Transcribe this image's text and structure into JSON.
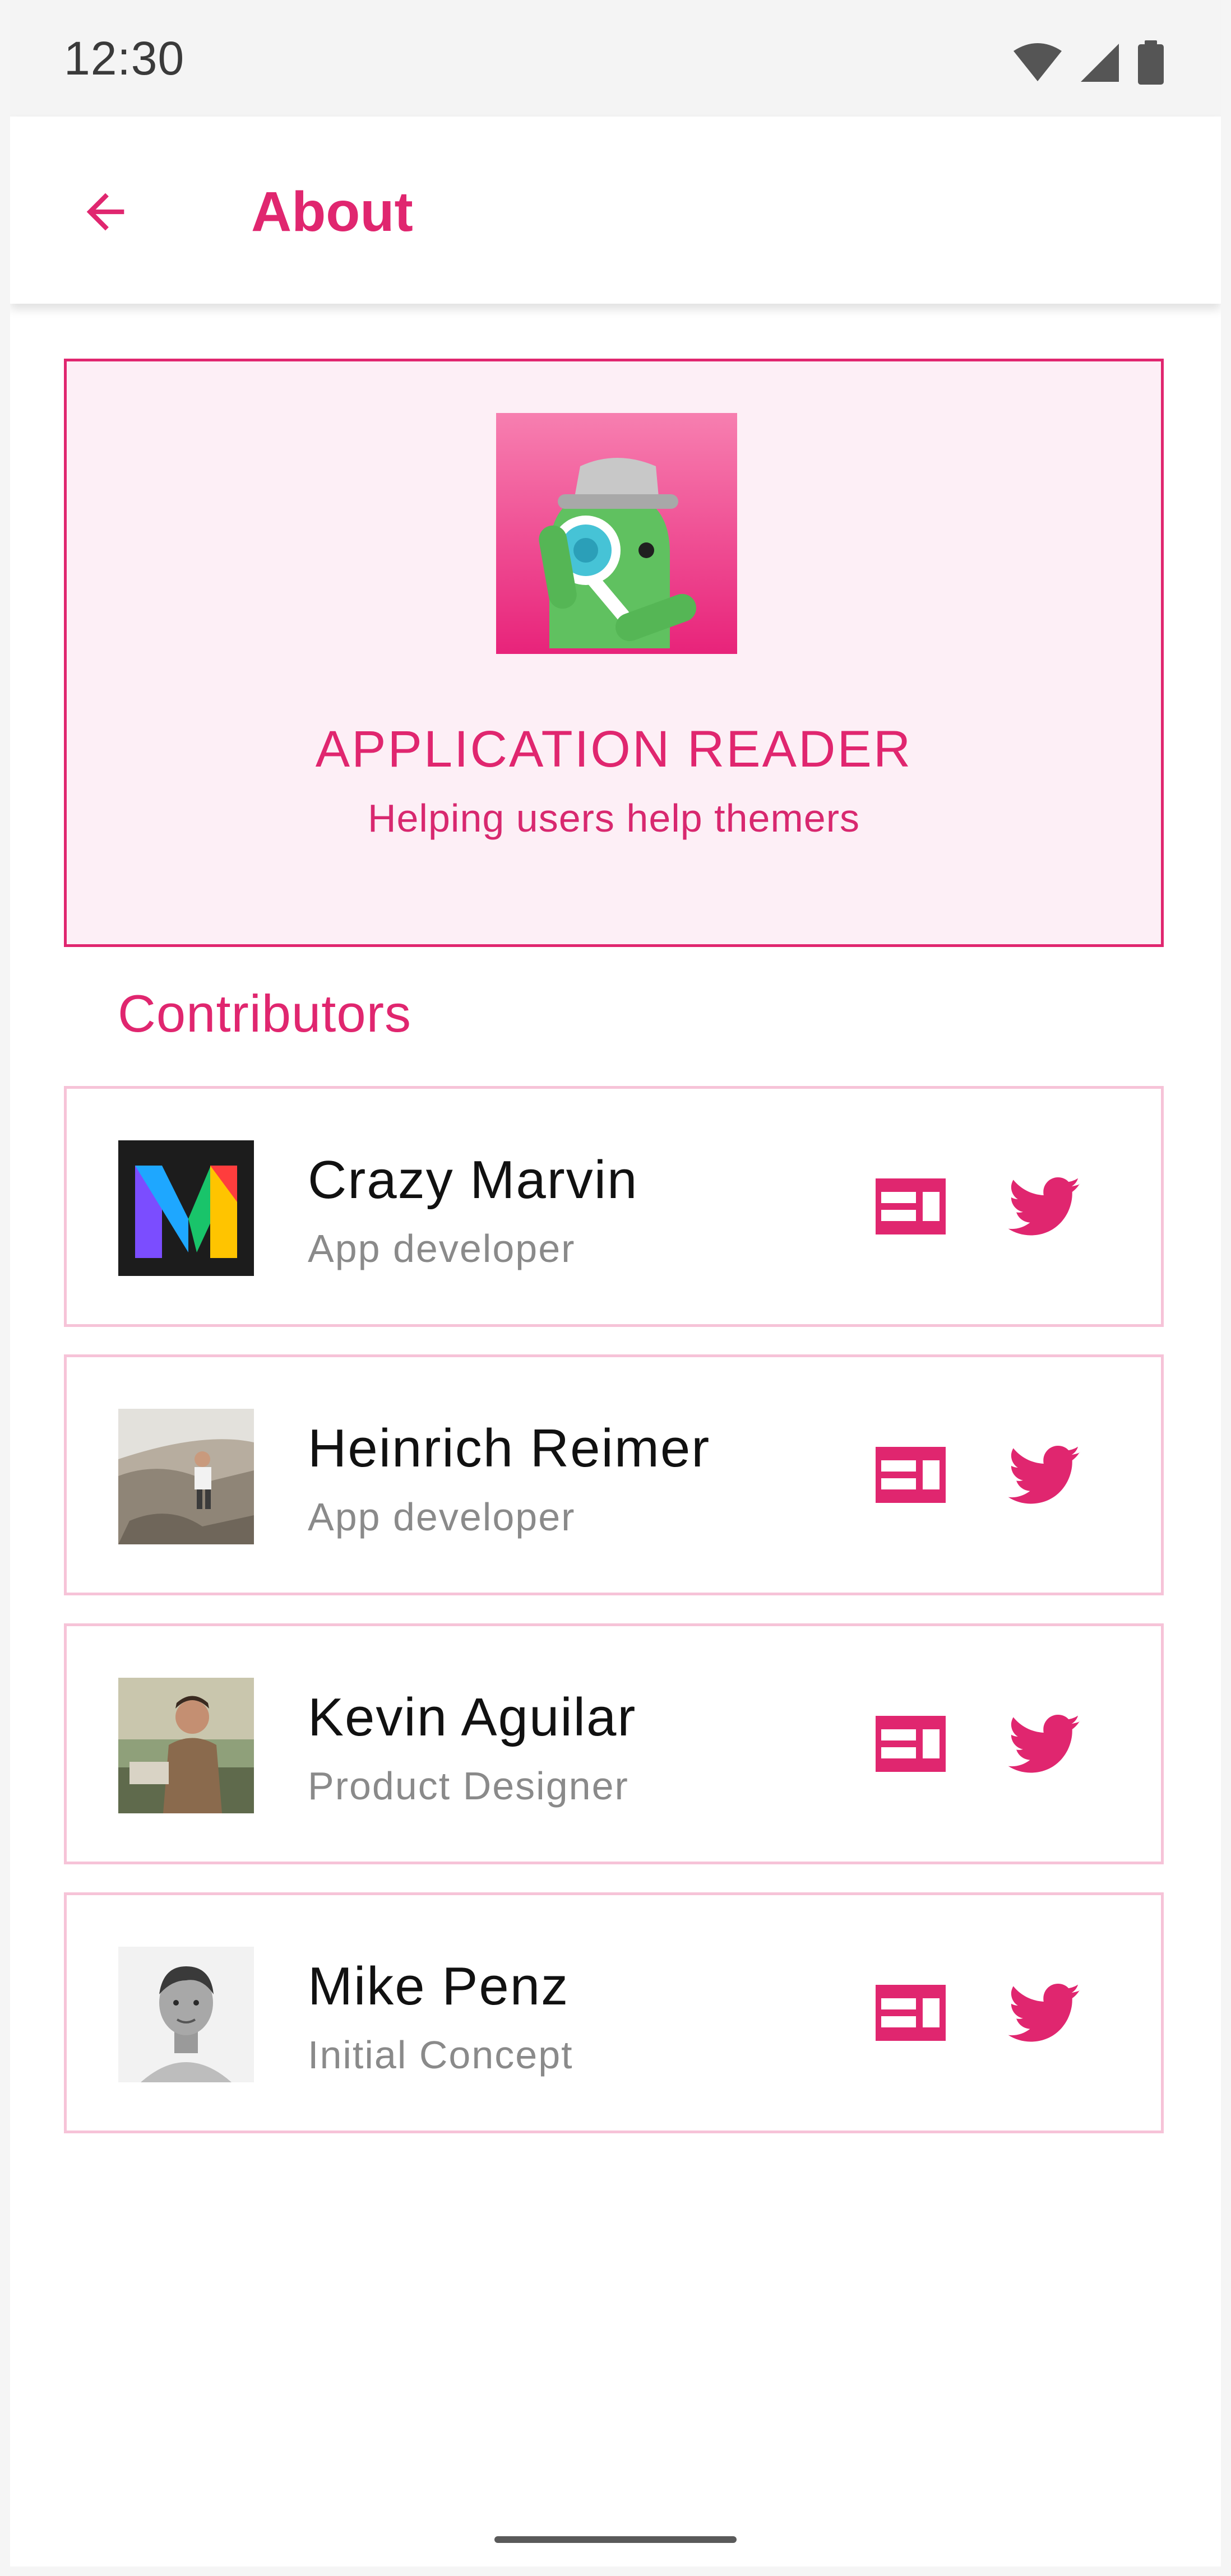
{
  "status_bar": {
    "time": "12:30",
    "icons": [
      "wifi-icon",
      "signal-icon",
      "battery-icon"
    ]
  },
  "app_bar": {
    "title": "About",
    "back_icon": "arrow-back-icon"
  },
  "hero": {
    "title": "APPLICATION READER",
    "subtitle": "Helping users help themers",
    "logo_icon": "detective-android-logo"
  },
  "contributors": {
    "title": "Contributors",
    "items": [
      {
        "name": "Crazy Marvin",
        "role": "App developer",
        "avatar": "colorful-m-logo"
      },
      {
        "name": "Heinrich Reimer",
        "role": "App developer",
        "avatar": "climber-photo"
      },
      {
        "name": "Kevin Aguilar",
        "role": "Product Designer",
        "avatar": "outdoor-portrait-photo"
      },
      {
        "name": "Mike Penz",
        "role": "Initial Concept",
        "avatar": "bw-portrait-photo"
      }
    ],
    "action_icons": [
      "website-icon",
      "twitter-icon"
    ]
  },
  "colors": {
    "accent": "#e0266f",
    "hero_background": "#fdeff6",
    "card_border": "#f6c3d8"
  }
}
